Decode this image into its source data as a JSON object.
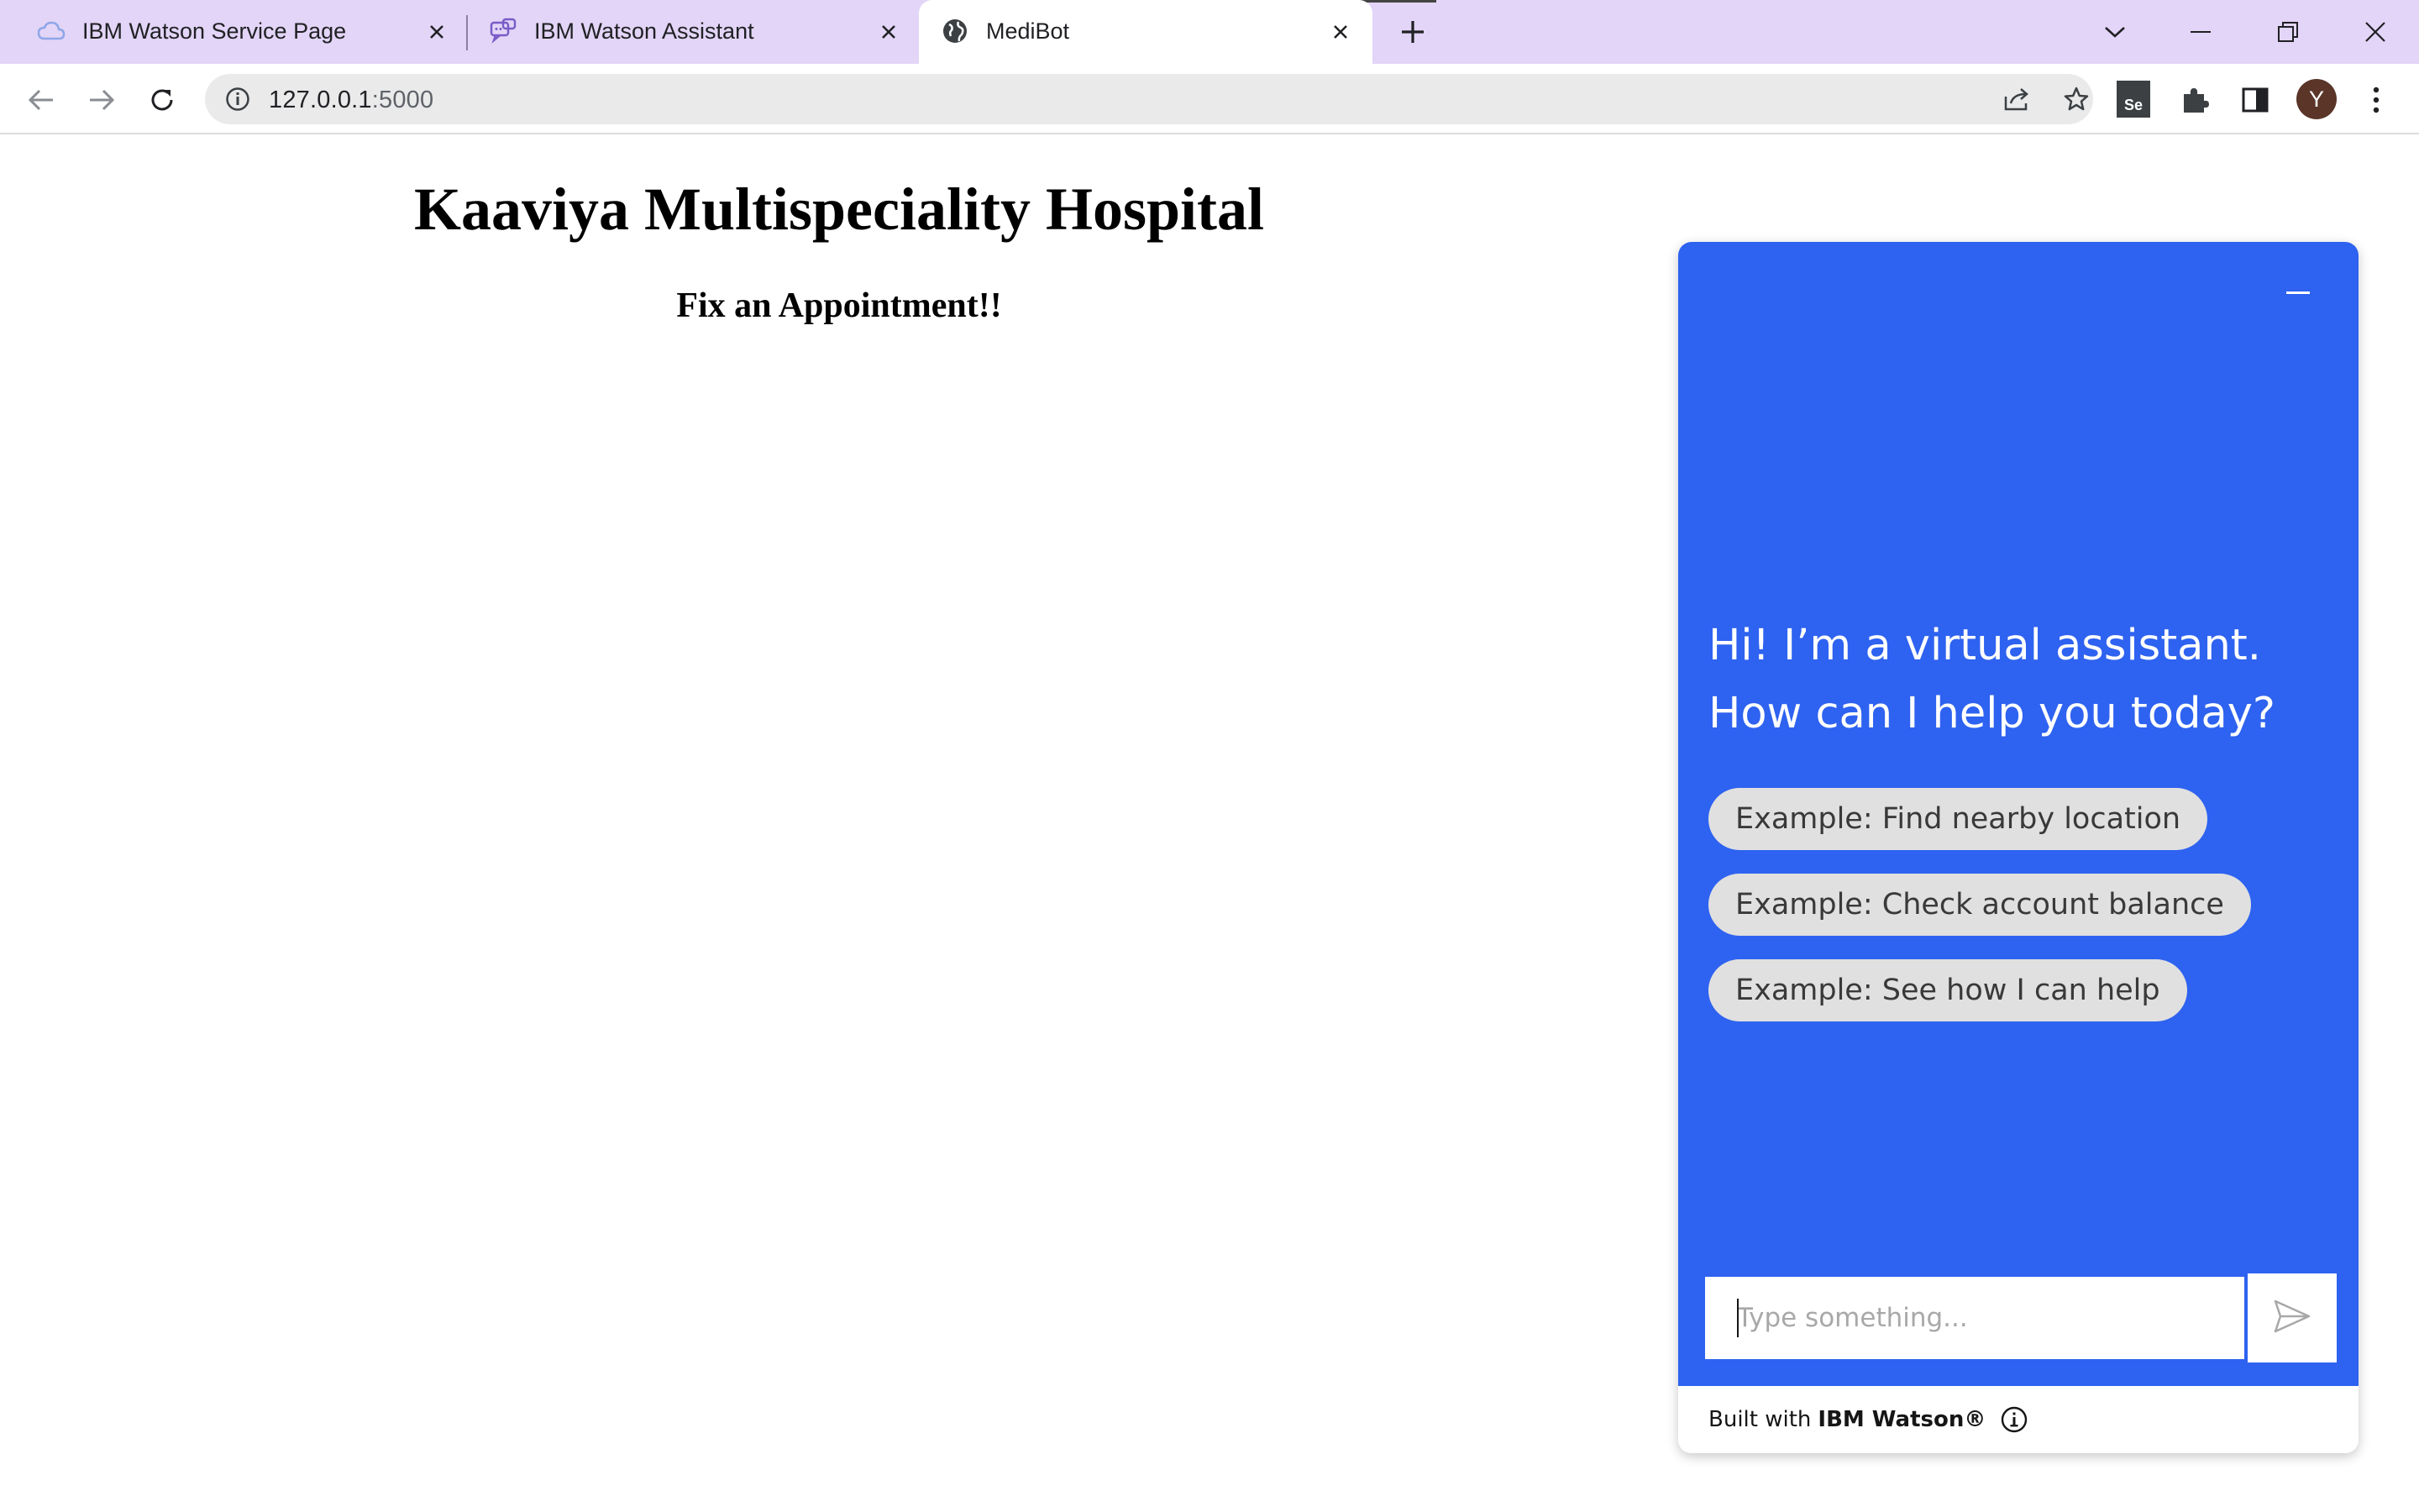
{
  "browser": {
    "tabs": [
      {
        "title": "IBM Watson Service Page",
        "icon": "cloud-icon",
        "active": false
      },
      {
        "title": "IBM Watson Assistant",
        "icon": "chat-bubbles-icon",
        "active": false
      },
      {
        "title": "MediBot",
        "icon": "globe-icon",
        "active": true
      }
    ],
    "url_host": "127.0.0.1",
    "url_port": ":5000",
    "profile_initial": "Y",
    "extension_label": "Se"
  },
  "page": {
    "title": "Kaaviya Multispeciality Hospital",
    "subtitle": "Fix an Appointment!!"
  },
  "chat": {
    "greeting": "Hi! I’m a virtual assistant. How can I help you today?",
    "suggestions": [
      "Example: Find nearby location",
      "Example: Check account balance",
      "Example: See how I can help"
    ],
    "input_placeholder": "Type something...",
    "input_value": "",
    "footer_prefix": "Built with",
    "footer_brand": "IBM Watson®"
  },
  "colors": {
    "tabstrip": "#e3d5f7",
    "chat_accent": "#2e62f0",
    "suggestion_bg": "#e0e0e0"
  }
}
